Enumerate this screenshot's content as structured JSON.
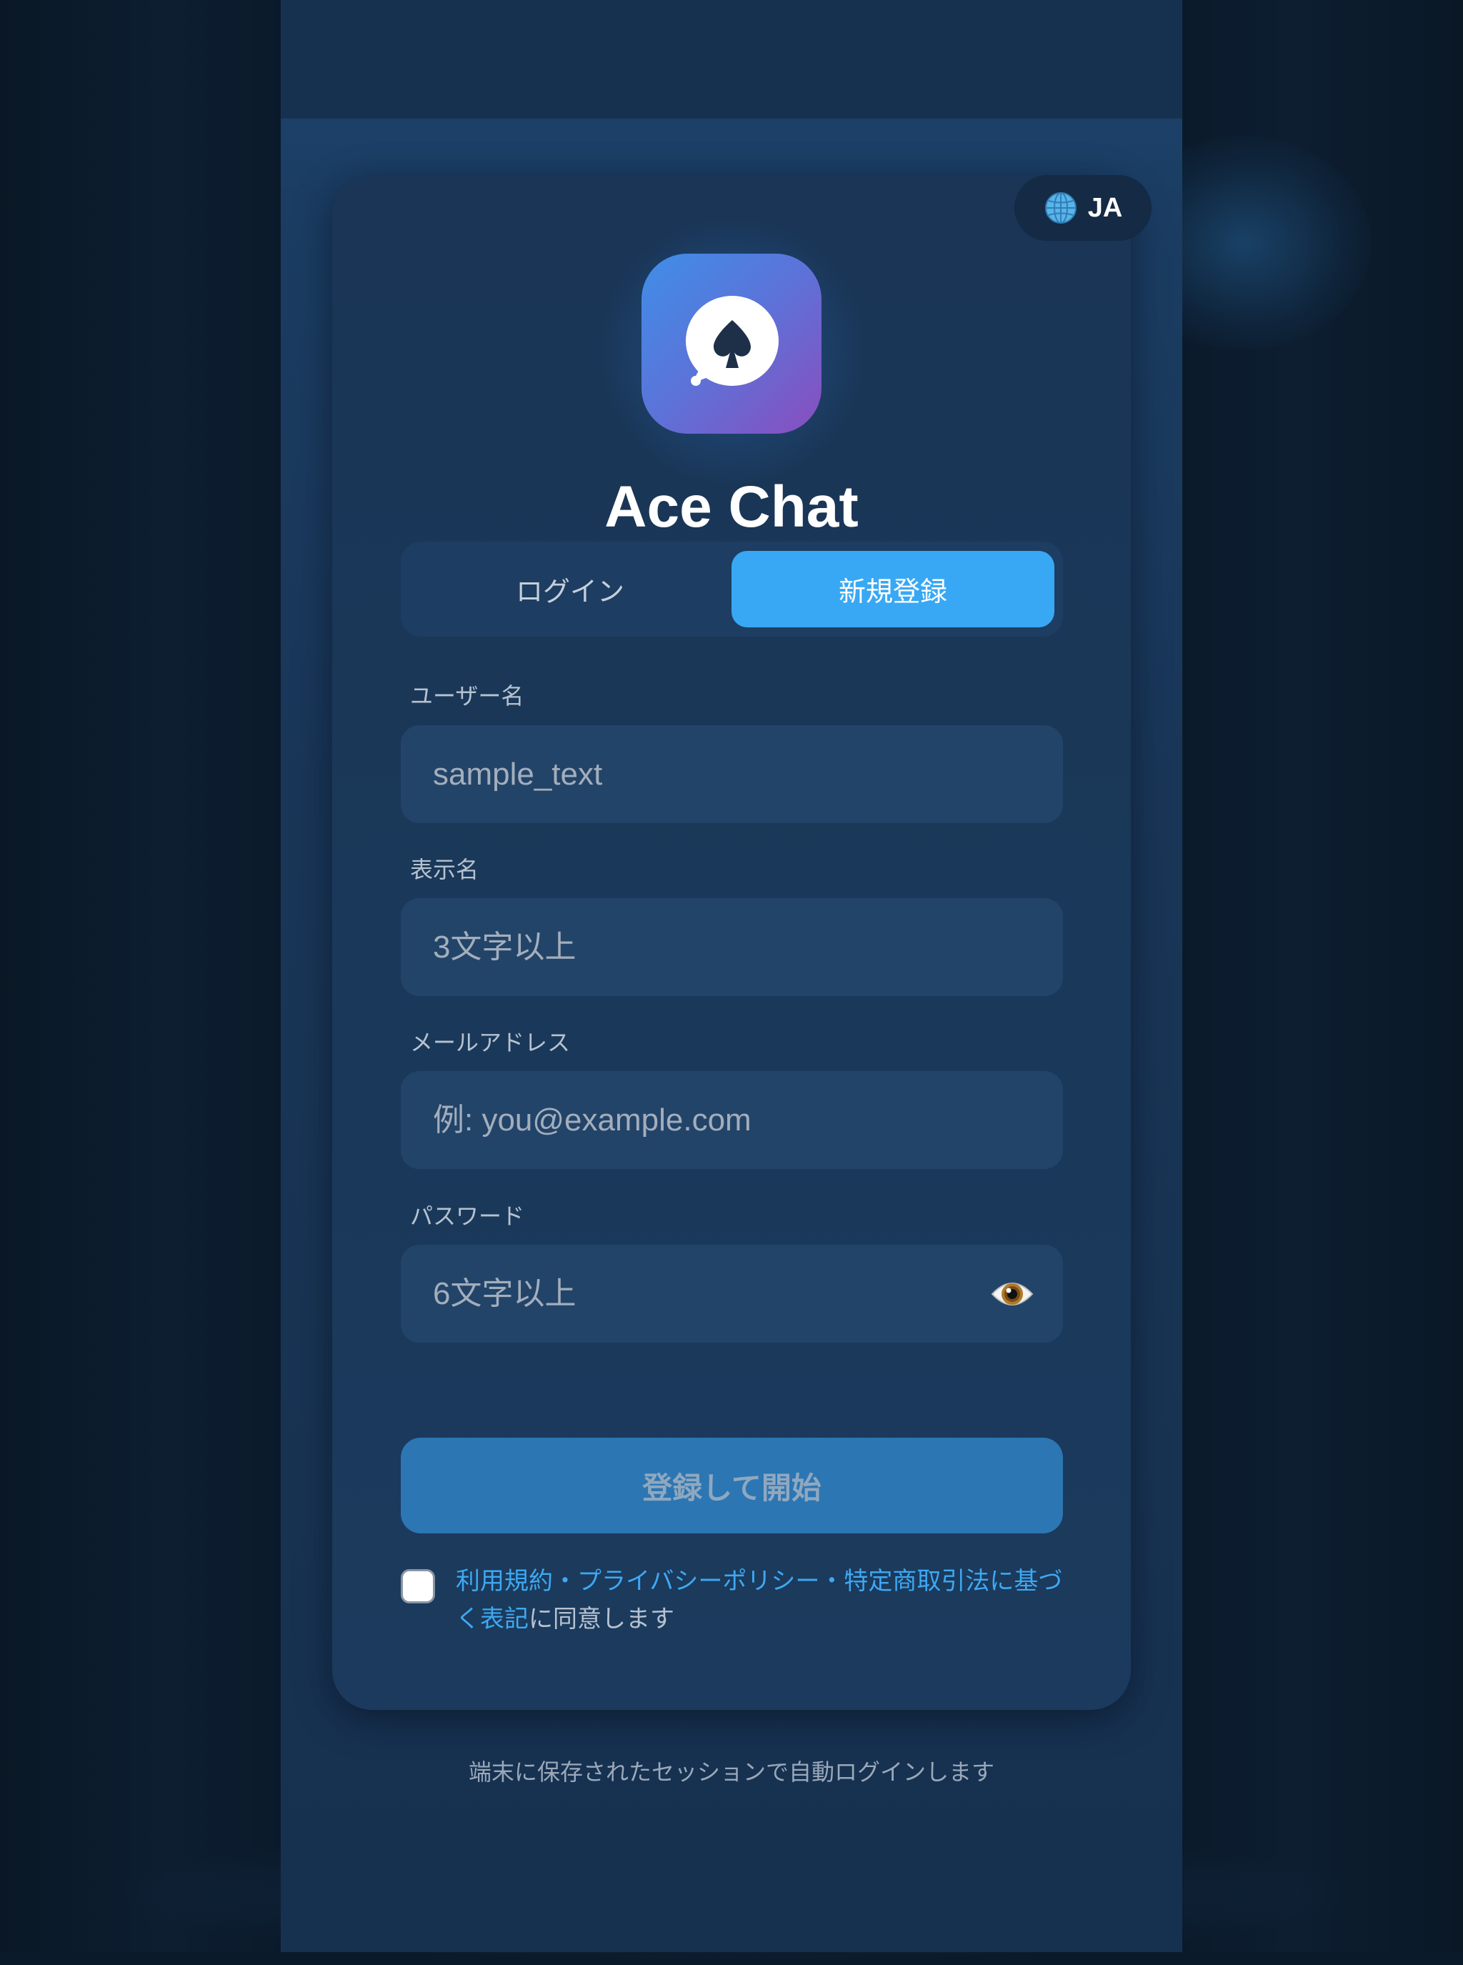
{
  "language_button": {
    "icon": "globe-icon",
    "label": "JA"
  },
  "app": {
    "logo_icon": "spade-chat-bubble-icon",
    "title": "Ace Chat"
  },
  "tabs": [
    {
      "label": "ログイン",
      "selected": false
    },
    {
      "label": "新規登録",
      "selected": true
    }
  ],
  "form": {
    "username": {
      "label": "ユーザー名",
      "placeholder": "sample_text",
      "value": ""
    },
    "display_name": {
      "label": "表示名",
      "placeholder": "3文字以上",
      "value": ""
    },
    "email": {
      "label": "メールアドレス",
      "placeholder": "例: you@example.com",
      "value": ""
    },
    "password": {
      "label": "パスワード",
      "placeholder": "6文字以上",
      "value": "",
      "toggle_icon": "eye-icon"
    },
    "submit_label": "登録して開始"
  },
  "agreement": {
    "checked": false,
    "link_text": "利用規約・プライバシーポリシー・特定商取引法に基づく表記",
    "suffix": "に同意します"
  },
  "footer_note": "端末に保存されたセッションで自動ログインします",
  "colors": {
    "accent": "#38a8f4",
    "link": "#3ea8f2",
    "submit_button": "#2c76b3",
    "logo_gradient_start": "#3f8ee8",
    "logo_gradient_end": "#8a4dbe"
  }
}
